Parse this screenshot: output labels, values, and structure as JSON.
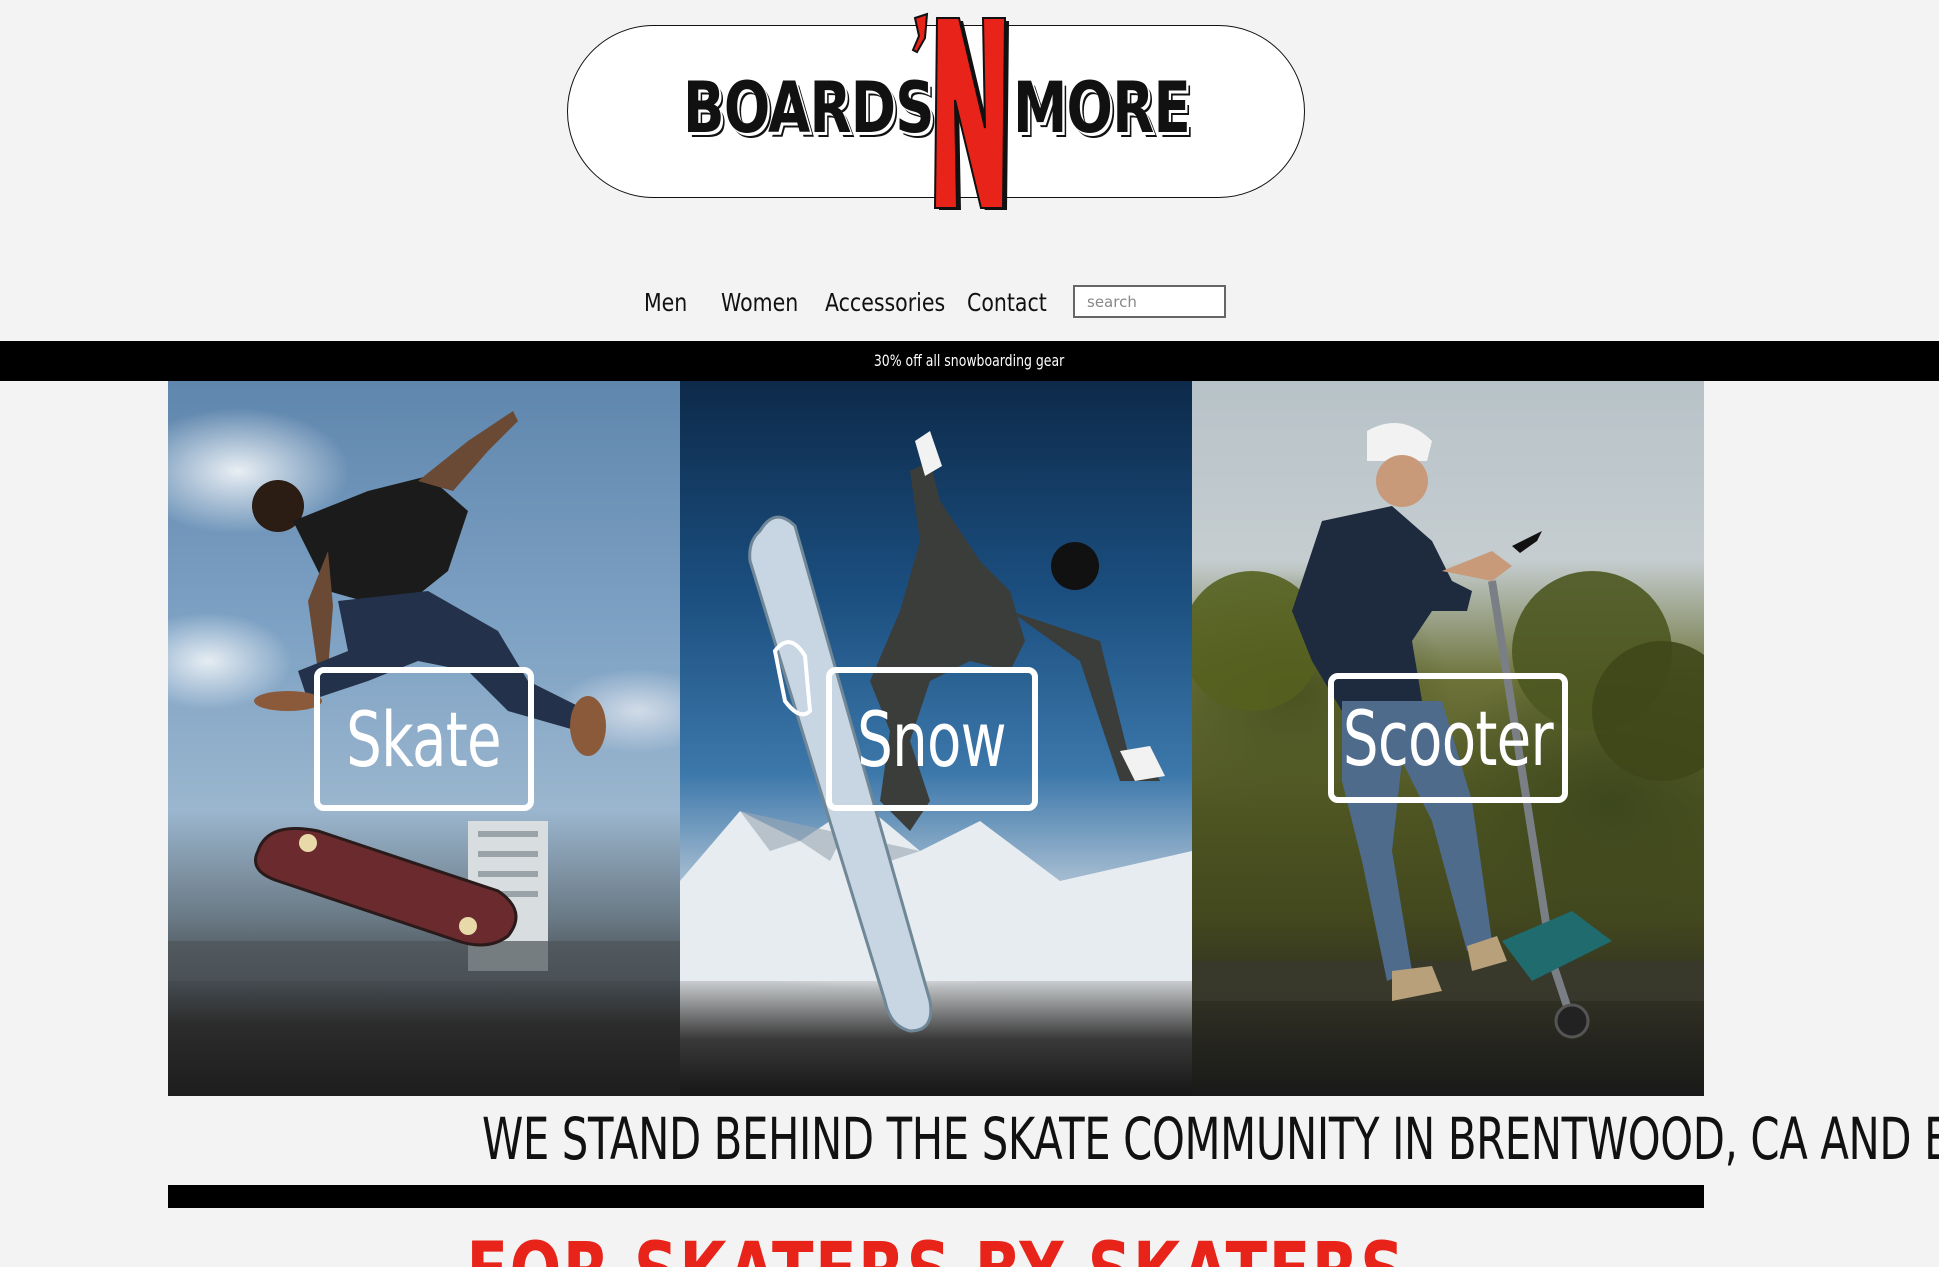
{
  "logo": {
    "left_text": "BOARDS",
    "right_text": "MORE",
    "accent_text": "'N",
    "accent_color": "#e8231a"
  },
  "nav": {
    "items": [
      {
        "label": "Men"
      },
      {
        "label": "Women"
      },
      {
        "label": "Accessories"
      },
      {
        "label": "Contact"
      }
    ],
    "search": {
      "placeholder": "search",
      "value": ""
    }
  },
  "promo": {
    "text": "30% off all snowboarding gear"
  },
  "hero": {
    "panels": [
      {
        "label": "Skate"
      },
      {
        "label": "Snow"
      },
      {
        "label": "Scooter"
      }
    ]
  },
  "community": {
    "tagline": "WE STAND BEHIND THE SKATE COMMUNITY IN BRENTWOOD, CA AND BEYOND",
    "slogan": "FOR SKATERS BY SKATERS"
  },
  "colors": {
    "background": "#f3f3f3",
    "promo_bar": "#000000",
    "slogan": "#e8231a"
  }
}
